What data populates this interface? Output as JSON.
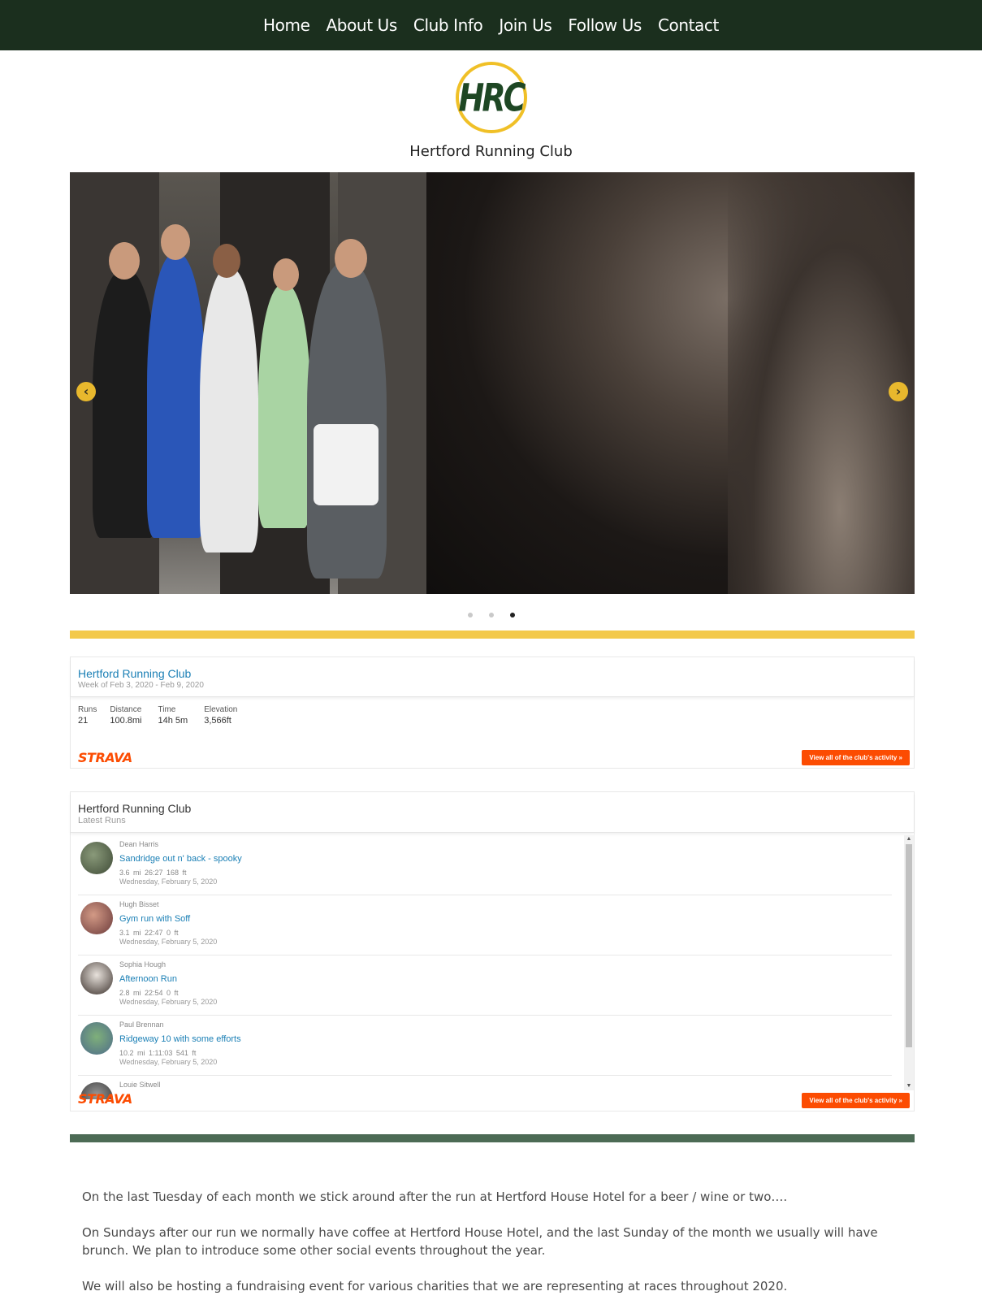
{
  "nav": {
    "items": [
      "Home",
      "About Us",
      "Club Info",
      "Join Us",
      "Follow Us",
      "Contact"
    ]
  },
  "header": {
    "logo_text": "HRC",
    "site_title": "Hertford Running Club"
  },
  "slider": {
    "prev_icon": "‹",
    "next_icon": "›",
    "slide_count": 3,
    "active_slide": 3
  },
  "strava_summary": {
    "club_name": "Hertford Running Club",
    "week": "Week of Feb 3, 2020 - Feb 9, 2020",
    "stats": [
      {
        "label": "Runs",
        "value": "21"
      },
      {
        "label": "Distance",
        "value": "100.8mi"
      },
      {
        "label": "Time",
        "value": "14h 5m"
      },
      {
        "label": "Elevation",
        "value": "3,566ft"
      }
    ],
    "brand": "STRAVA",
    "view_all": "View all of the club's activity »"
  },
  "strava_latest": {
    "club_name": "Hertford Running Club",
    "subtitle": "Latest Runs",
    "runs": [
      {
        "athlete": "Dean Harris",
        "name": "Sandridge out n' back - spooky",
        "stats": "3.6 mi    26:27    168 ft",
        "date": "Wednesday, February 5, 2020"
      },
      {
        "athlete": "Hugh Bisset",
        "name": "Gym run with Soff",
        "stats": "3.1 mi    22:47    0 ft",
        "date": "Wednesday, February 5, 2020"
      },
      {
        "athlete": "Sophia Hough",
        "name": "Afternoon Run",
        "stats": "2.8 mi    22:54    0 ft",
        "date": "Wednesday, February 5, 2020"
      },
      {
        "athlete": "Paul Brennan",
        "name": "Ridgeway 10 with some efforts",
        "stats": "10.2 mi    1:11:03    541 ft",
        "date": "Wednesday, February 5, 2020"
      },
      {
        "athlete": "Louie Sitwell",
        "name": "",
        "stats": "",
        "date": ""
      }
    ],
    "brand": "STRAVA",
    "view_all": "View all of the club's activity »",
    "scroll_up": "▲",
    "scroll_down": "▼"
  },
  "content": {
    "paragraphs": [
      "On the last Tuesday of each month we stick around after the run at Hertford House Hotel for a beer / wine or two….",
      "On Sundays after our run we normally have coffee at Hertford House Hotel, and the last Sunday of the month we usually will have brunch. We plan to introduce some other social events throughout the year.",
      "We will also be hosting a fundraising event for various charities that we are representing at races throughout 2020."
    ]
  },
  "colors": {
    "nav_bg": "#1b2f1e",
    "accent_yellow": "#f3c94b",
    "accent_green": "#4c6b55",
    "strava_orange": "#fc4c02",
    "link_blue": "#1a7fb5"
  }
}
